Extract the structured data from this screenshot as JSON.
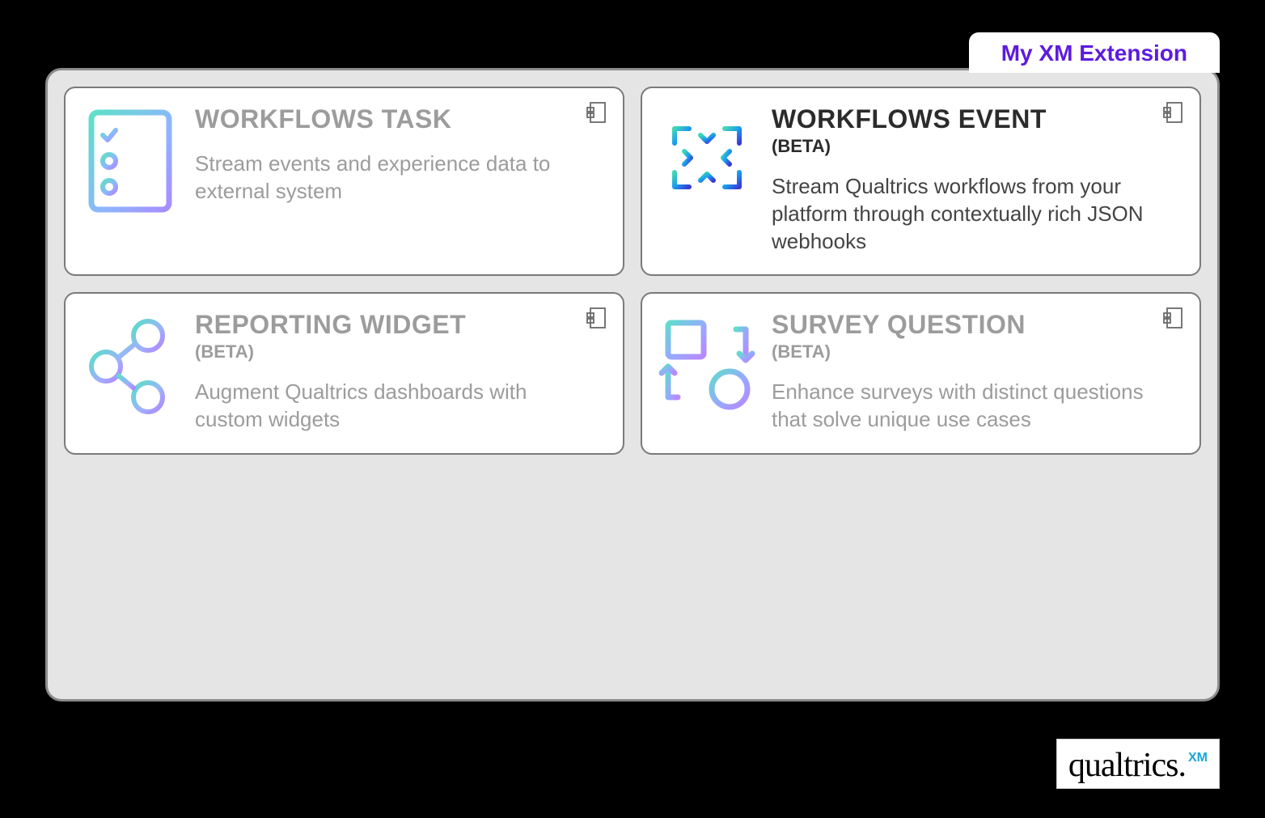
{
  "tab": {
    "label": "My XM Extension"
  },
  "cards": [
    {
      "title": "WORKFLOWS TASK",
      "subtitle": "",
      "desc": "Stream events and experience data to external system",
      "active": false
    },
    {
      "title": "WORKFLOWS EVENT",
      "subtitle": "(BETA)",
      "desc": "Stream Qualtrics workflows from your platform through contextually rich JSON webhooks",
      "active": true
    },
    {
      "title": "REPORTING WIDGET",
      "subtitle": "(BETA)",
      "desc": "Augment Qualtrics dashboards with custom widgets",
      "active": false
    },
    {
      "title": "SURVEY QUESTION",
      "subtitle": "(BETA)",
      "desc": "Enhance surveys with distinct questions that solve unique use cases",
      "active": false
    }
  ],
  "footer": {
    "brand": "qualtrics",
    "suffix": "XM"
  }
}
